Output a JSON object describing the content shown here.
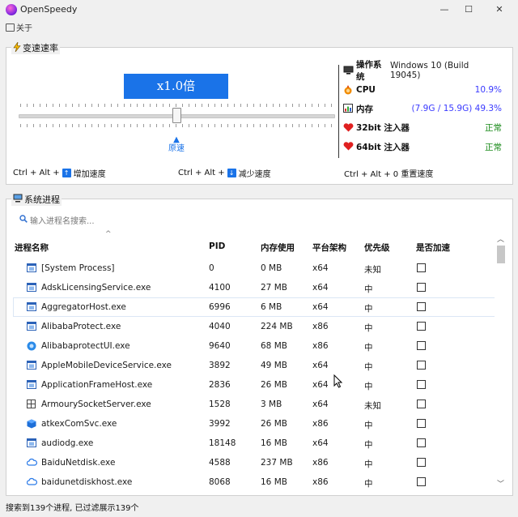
{
  "window": {
    "title": "OpenSpeedy",
    "minimize": "—",
    "maximize": "☐",
    "close": "✕"
  },
  "menu": {
    "about": "关于"
  },
  "speed": {
    "group_title": "变速速率",
    "display": "x1.0倍",
    "marker_label": "原速",
    "shortcuts": {
      "increase": {
        "prefix": "Ctrl + Alt +",
        "key": "↑",
        "label": "增加速度"
      },
      "decrease": {
        "prefix": "Ctrl + Alt +",
        "key": "↓",
        "label": "减少速度"
      },
      "reset": {
        "text": "Ctrl + Alt + 0 重置速度"
      }
    }
  },
  "system_info": [
    {
      "icon": "monitor-icon",
      "label": "操作系统",
      "value": "Windows 10 (Build 19045)",
      "color": "#222222"
    },
    {
      "icon": "cpu-icon",
      "label": "CPU",
      "value": "10.9%",
      "color": "#3a3aff"
    },
    {
      "icon": "memory-chart-icon",
      "label": "内存",
      "value": "(7.9G / 15.9G) 49.3%",
      "color": "#3a3aff"
    },
    {
      "icon": "heart-icon",
      "label": "32bit 注入器",
      "value": "正常",
      "color": "#1a8a1a"
    },
    {
      "icon": "heart-icon",
      "label": "64bit 注入器",
      "value": "正常",
      "color": "#1a8a1a"
    }
  ],
  "process": {
    "group_title": "系统进程",
    "search_placeholder": "输入进程名搜索...",
    "columns": [
      "进程名称",
      "PID",
      "内存使用",
      "平台架构",
      "优先级",
      "是否加速"
    ],
    "rows": [
      {
        "name": "[System Process]",
        "pid": "0",
        "mem": "0 MB",
        "arch": "x64",
        "prio": "未知",
        "icon": "window-icon"
      },
      {
        "name": "AdskLicensingService.exe",
        "pid": "4100",
        "mem": "27 MB",
        "arch": "x64",
        "prio": "中",
        "icon": "window-icon"
      },
      {
        "name": "AggregatorHost.exe",
        "pid": "6996",
        "mem": "6 MB",
        "arch": "x64",
        "prio": "中",
        "icon": "window-icon"
      },
      {
        "name": "AlibabaProtect.exe",
        "pid": "4040",
        "mem": "224 MB",
        "arch": "x86",
        "prio": "中",
        "icon": "window-icon"
      },
      {
        "name": "AlibabaprotectUI.exe",
        "pid": "9640",
        "mem": "68 MB",
        "arch": "x86",
        "prio": "中",
        "icon": "shield-icon"
      },
      {
        "name": "AppleMobileDeviceService.exe",
        "pid": "3892",
        "mem": "49 MB",
        "arch": "x64",
        "prio": "中",
        "icon": "window-icon"
      },
      {
        "name": "ApplicationFrameHost.exe",
        "pid": "2836",
        "mem": "26 MB",
        "arch": "x64",
        "prio": "中",
        "icon": "window-icon"
      },
      {
        "name": "ArmourySocketServer.exe",
        "pid": "1528",
        "mem": "3 MB",
        "arch": "x64",
        "prio": "未知",
        "icon": "grid-icon"
      },
      {
        "name": "atkexComSvc.exe",
        "pid": "3992",
        "mem": "26 MB",
        "arch": "x86",
        "prio": "中",
        "icon": "cube-icon"
      },
      {
        "name": "audiodg.exe",
        "pid": "18148",
        "mem": "16 MB",
        "arch": "x64",
        "prio": "中",
        "icon": "window-icon"
      },
      {
        "name": "BaiduNetdisk.exe",
        "pid": "4588",
        "mem": "237 MB",
        "arch": "x86",
        "prio": "中",
        "icon": "cloud-icon"
      },
      {
        "name": "baidunetdiskhost.exe",
        "pid": "8068",
        "mem": "16 MB",
        "arch": "x86",
        "prio": "中",
        "icon": "cloud-icon"
      }
    ]
  },
  "status": "搜索到139个进程, 已过滤展示139个",
  "colors": {
    "accent": "#1a73e8",
    "ok": "#1a8a1a",
    "metric": "#3a3aff"
  }
}
